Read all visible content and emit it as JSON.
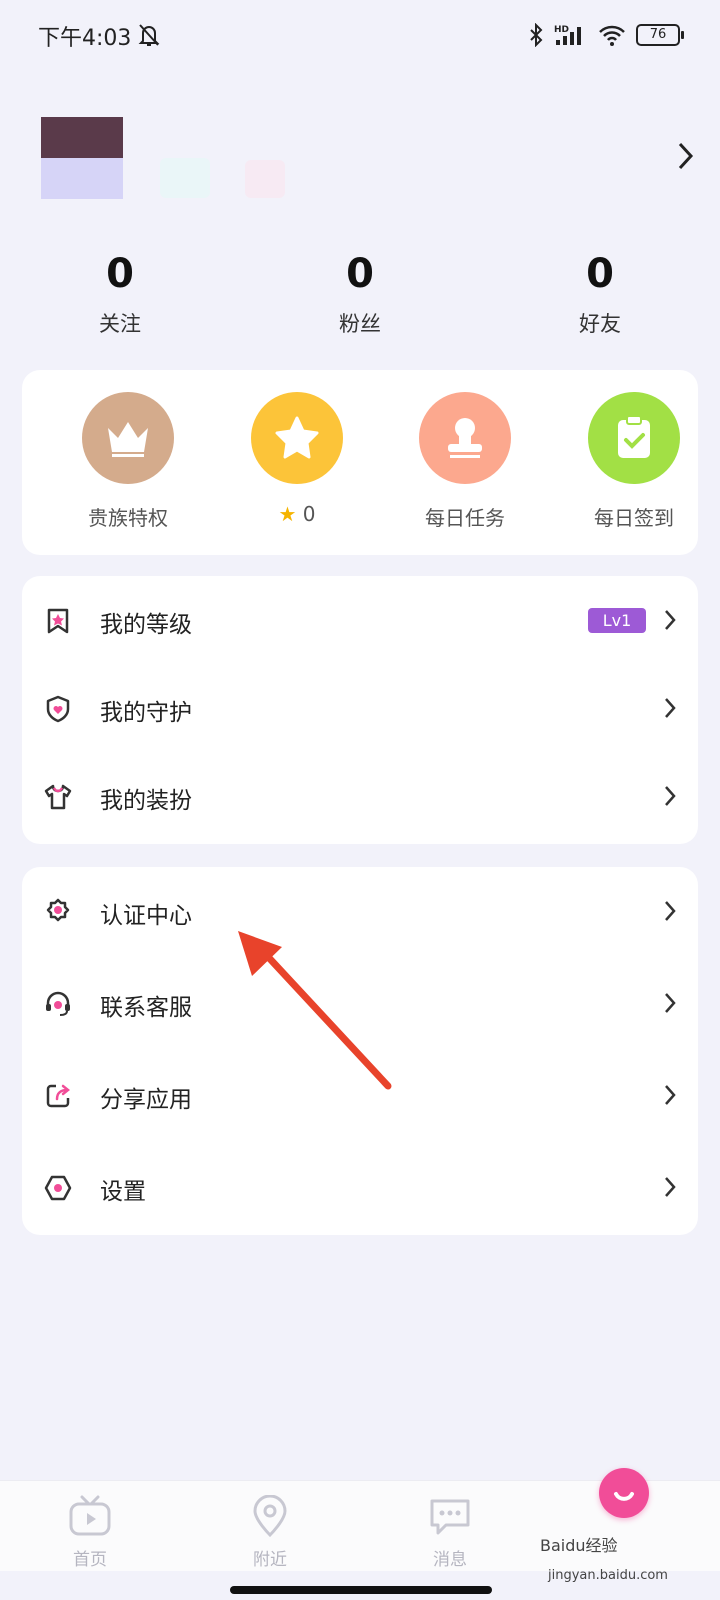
{
  "status": {
    "time": "下午4:03",
    "battery": "76",
    "network_badge": "HD"
  },
  "stats": [
    {
      "value": "0",
      "label": "关注"
    },
    {
      "value": "0",
      "label": "粉丝"
    },
    {
      "value": "0",
      "label": "好友"
    }
  ],
  "quick_actions": [
    {
      "label": "贵族特权",
      "icon": "crown-icon",
      "color": "#d4ab8c"
    },
    {
      "label": "0",
      "icon": "star-icon",
      "color": "#fcc439"
    },
    {
      "label": "每日任务",
      "icon": "stamp-icon",
      "color": "#fca88e"
    },
    {
      "label": "每日签到",
      "icon": "clipboard-check-icon",
      "color": "#a2e045"
    }
  ],
  "menu_group_1": [
    {
      "label": "我的等级",
      "badge": "Lv1",
      "icon": "bookmark-star-icon"
    },
    {
      "label": "我的守护",
      "icon": "shield-heart-icon"
    },
    {
      "label": "我的装扮",
      "icon": "shirt-icon"
    }
  ],
  "menu_group_2": [
    {
      "label": "认证中心",
      "icon": "verified-badge-icon"
    },
    {
      "label": "联系客服",
      "icon": "headset-icon"
    },
    {
      "label": "分享应用",
      "icon": "share-icon"
    },
    {
      "label": "设置",
      "icon": "hexagon-settings-icon"
    }
  ],
  "bottom_nav": [
    {
      "label": "首页",
      "icon": "tv-icon"
    },
    {
      "label": "附近",
      "icon": "location-pin-icon"
    },
    {
      "label": "消息",
      "icon": "chat-icon"
    }
  ],
  "watermark": {
    "text": "Baidu经验",
    "url": "jingyan.baidu.com"
  },
  "colors": {
    "accent_pink": "#f14d98",
    "level_badge": "#9d5ad6",
    "annotation": "#e8432b"
  }
}
